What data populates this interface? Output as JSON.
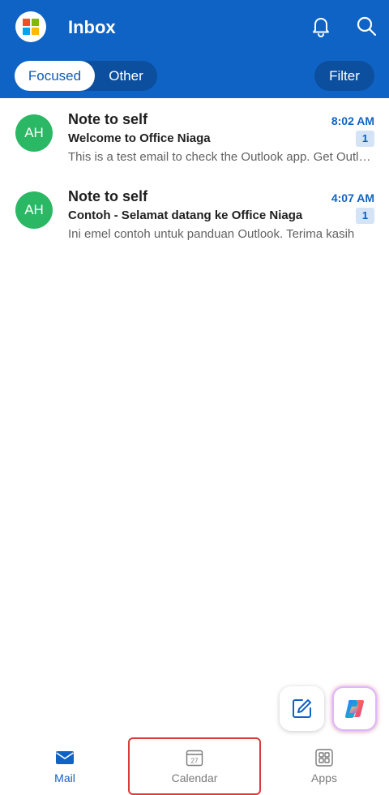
{
  "header": {
    "title": "Inbox",
    "logo_icon": "microsoft-logo-icon",
    "notifications_icon": "bell-icon",
    "search_icon": "search-icon",
    "background_color": "#0f63c4"
  },
  "pivot": {
    "focused_label": "Focused",
    "other_label": "Other",
    "selected": "Focused"
  },
  "filter": {
    "label": "Filter"
  },
  "messages": [
    {
      "avatar_initials": "AH",
      "sender": "Note to self",
      "time": "8:02 AM",
      "subject": "Welcome to Office Niaga",
      "count": "1",
      "preview": "This is a test email to check the Outlook app. Get Outlook for Android"
    },
    {
      "avatar_initials": "AH",
      "sender": "Note to self",
      "time": "4:07 AM",
      "subject": "Contoh - Selamat datang ke Office Niaga",
      "count": "1",
      "preview": "Ini emel contoh untuk panduan Outlook. Terima kasih"
    }
  ],
  "fabs": {
    "compose_icon": "compose-icon",
    "copilot_icon": "copilot-icon"
  },
  "tabbar": {
    "mail_label": "Mail",
    "calendar_label": "Calendar",
    "calendar_day": "27",
    "apps_label": "Apps",
    "selected": "Mail"
  },
  "colors": {
    "accent": "#0f63c4",
    "avatar": "#2bb864",
    "highlight": "#d93a3a"
  }
}
